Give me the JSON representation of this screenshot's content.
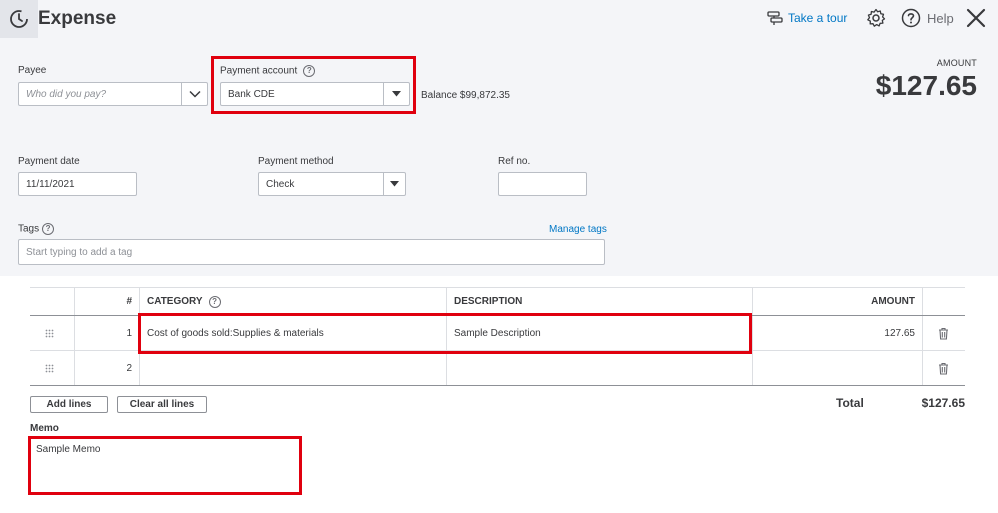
{
  "header": {
    "title": "Expense",
    "tour_label": "Take a tour",
    "help_label": "Help"
  },
  "payee": {
    "label": "Payee",
    "placeholder": "Who did you pay?"
  },
  "payment_account": {
    "label": "Payment account",
    "value": "Bank CDE",
    "balance_label": "Balance",
    "balance_value": "$99,872.35"
  },
  "amount": {
    "label": "AMOUNT",
    "value": "$127.65"
  },
  "payment_date": {
    "label": "Payment date",
    "value": "11/11/2021"
  },
  "payment_method": {
    "label": "Payment method",
    "value": "Check"
  },
  "ref_no": {
    "label": "Ref no.",
    "value": ""
  },
  "tags": {
    "label": "Tags",
    "manage_label": "Manage tags",
    "placeholder": "Start typing to add a tag"
  },
  "table": {
    "headers": {
      "num": "#",
      "category": "CATEGORY",
      "description": "DESCRIPTION",
      "amount": "AMOUNT"
    },
    "rows": [
      {
        "num": "1",
        "category": "Cost of goods sold:Supplies & materials",
        "description": "Sample Description",
        "amount": "127.65"
      },
      {
        "num": "2",
        "category": "",
        "description": "",
        "amount": ""
      }
    ]
  },
  "buttons": {
    "add_lines": "Add lines",
    "clear_all_lines": "Clear all lines"
  },
  "total": {
    "label": "Total",
    "value": "$127.65"
  },
  "memo": {
    "label": "Memo",
    "value": "Sample Memo"
  },
  "colors": {
    "accent": "#0077c5",
    "highlight": "#e0000e",
    "panel": "#f4f5f8"
  }
}
